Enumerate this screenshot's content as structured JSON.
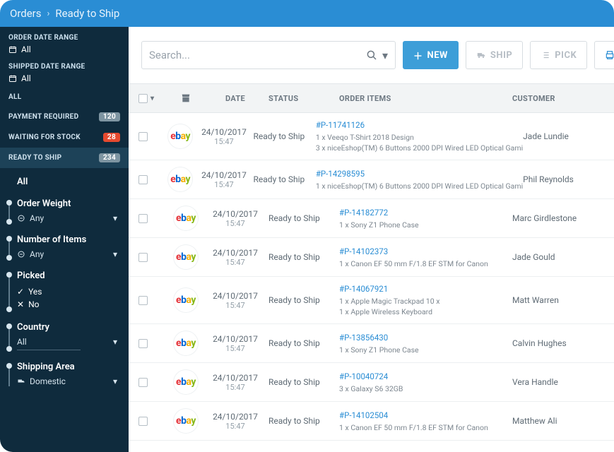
{
  "breadcrumb": {
    "root": "Orders",
    "current": "Ready to Ship"
  },
  "sidebar": {
    "orderDateRange": {
      "label": "ORDER DATE RANGE",
      "value": "All"
    },
    "shippedDateRange": {
      "label": "SHIPPED DATE RANGE",
      "value": "All"
    },
    "statuses": [
      {
        "label": "ALL",
        "count": ""
      },
      {
        "label": "PAYMENT REQUIRED",
        "count": "120",
        "badge": "grey"
      },
      {
        "label": "WAITING FOR STOCK",
        "count": "28",
        "badge": "red"
      },
      {
        "label": "READY TO SHIP",
        "count": "234",
        "badge": "grey",
        "active": true
      }
    ],
    "filters": {
      "all": "All",
      "orderWeight": {
        "title": "Order Weight",
        "value": "Any"
      },
      "numberItems": {
        "title": "Number of Items",
        "value": "Any"
      },
      "picked": {
        "title": "Picked",
        "yes": "Yes",
        "no": "No"
      },
      "country": {
        "title": "Country",
        "value": "All"
      },
      "shippingArea": {
        "title": "Shipping Area",
        "value": "Domestic"
      }
    }
  },
  "toolbar": {
    "searchPlaceholder": "Search...",
    "new": "NEW",
    "ship": "SHIP",
    "pick": "PICK",
    "print": "PRI"
  },
  "columns": {
    "date": "DATE",
    "status": "STATUS",
    "items": "ORDER ITEMS",
    "customer": "CUSTOMER"
  },
  "orders": [
    {
      "store": "ebay",
      "date": "24/10/2017",
      "time": "15:47",
      "status": "Ready to Ship",
      "pid": "#P-11741126",
      "lines": [
        "1 x Veeqo T-Shirt 2018 Design",
        "3 x niceEshop(TM) 6 Buttons 2000 DPI Wired LED Optical Gami"
      ],
      "customer": "Jade Lundie"
    },
    {
      "store": "ebay",
      "date": "24/10/2017",
      "time": "15:47",
      "status": "Ready to Ship",
      "pid": "#P-14298595",
      "lines": [
        "1 x niceEshop(TM) 6 Buttons 2000 DPI Wired LED Optical Gami"
      ],
      "customer": "Phil Reynolds"
    },
    {
      "store": "ebay",
      "date": "24/10/2017",
      "time": "15:47",
      "status": "Ready to Ship",
      "pid": "#P-14182772",
      "lines": [
        "1 x Sony Z1 Phone Case"
      ],
      "customer": "Marc Girdlestone"
    },
    {
      "store": "ebay",
      "date": "24/10/2017",
      "time": "15:47",
      "status": "Ready to Ship",
      "pid": "#P-14102373",
      "lines": [
        "1 x Canon EF 50 mm F/1.8 EF STM for Canon"
      ],
      "customer": "Jade Gould"
    },
    {
      "store": "ebay",
      "date": "24/10/2017",
      "time": "15:47",
      "status": "Ready to Ship",
      "pid": "#P-14067921",
      "lines": [
        "1 x Apple Magic Trackpad 10 x",
        "1 x Apple Wireless Keyboard"
      ],
      "customer": "Matt Warren"
    },
    {
      "store": "ebay",
      "date": "24/10/2017",
      "time": "15:47",
      "status": "Ready to Ship",
      "pid": "#P-13856430",
      "lines": [
        "1 x Sony Z1 Phone Case"
      ],
      "customer": "Calvin Hughes"
    },
    {
      "store": "ebay",
      "date": "24/10/2017",
      "time": "15:47",
      "status": "Ready to Ship",
      "pid": "#P-10040724",
      "lines": [
        "3 x Galaxy S6 32GB"
      ],
      "customer": "Vera Handle"
    },
    {
      "store": "ebay",
      "date": "24/10/2017",
      "time": "15:47",
      "status": "Ready to Ship",
      "pid": "#P-14102504",
      "lines": [
        "1 x Canon EF 50 mm F/1.8 EF STM for Canon"
      ],
      "customer": "Matthew Ali"
    }
  ]
}
